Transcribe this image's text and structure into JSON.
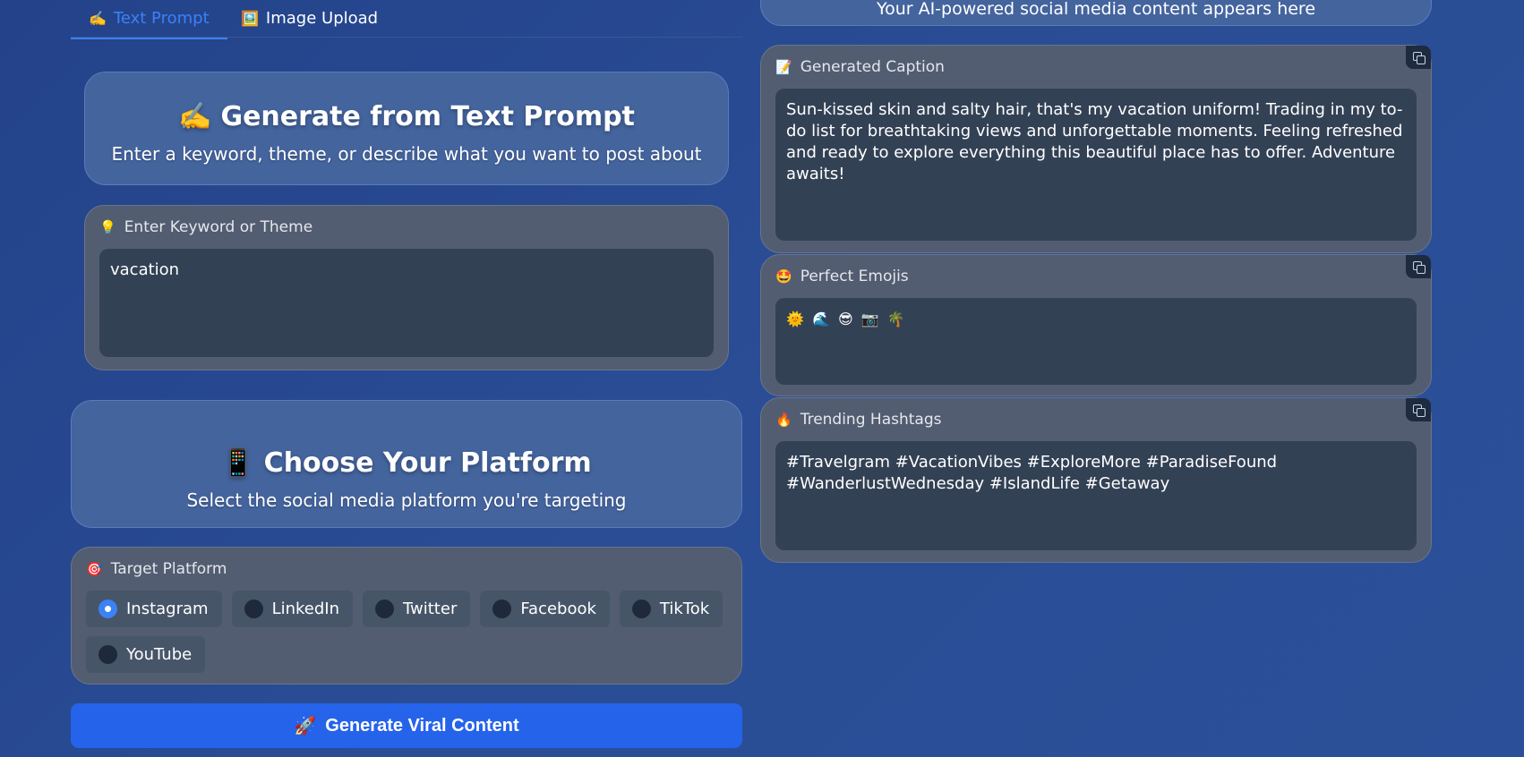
{
  "tabs": [
    {
      "icon": "✍️",
      "label": "Text Prompt",
      "active": true
    },
    {
      "icon": "🖼️",
      "label": "Image Upload",
      "active": false
    }
  ],
  "text_prompt": {
    "title_icon": "✍️",
    "title": "Generate from Text Prompt",
    "subtitle": "Enter a keyword, theme, or describe what you want to post about",
    "keyword_label_icon": "💡",
    "keyword_label": "Enter Keyword or Theme",
    "keyword_value": "vacation"
  },
  "platform": {
    "title_icon": "📱",
    "title": "Choose Your Platform",
    "subtitle": "Select the social media platform you're targeting",
    "label_icon": "🎯",
    "label": "Target Platform",
    "options": [
      "Instagram",
      "LinkedIn",
      "Twitter",
      "Facebook",
      "TikTok",
      "YouTube"
    ],
    "selected": "Instagram"
  },
  "generate_button": {
    "icon": "🚀",
    "label": "Generate Viral Content"
  },
  "output": {
    "banner_text": "Your AI-powered social media content appears here",
    "caption": {
      "icon": "📝",
      "label": "Generated Caption",
      "value": "Sun-kissed skin and salty hair, that's my vacation uniform! Trading in my to-do list for breathtaking views and unforgettable moments. Feeling refreshed and ready to explore everything this beautiful place has to offer. Adventure awaits!"
    },
    "emojis": {
      "icon": "🤩",
      "label": "Perfect Emojis",
      "value": "🌞 🌊 😎 📷 🌴"
    },
    "hashtags": {
      "icon": "🔥",
      "label": "Trending Hashtags",
      "value": "#Travelgram #VacationVibes #ExploreMore #ParadiseFound #WanderlustWednesday #IslandLife #Getaway"
    }
  },
  "colors": {
    "accent": "#3b82f6",
    "button": "#2563eb",
    "panel": "#525d72",
    "field": "#334155",
    "hero": "#44649e"
  }
}
